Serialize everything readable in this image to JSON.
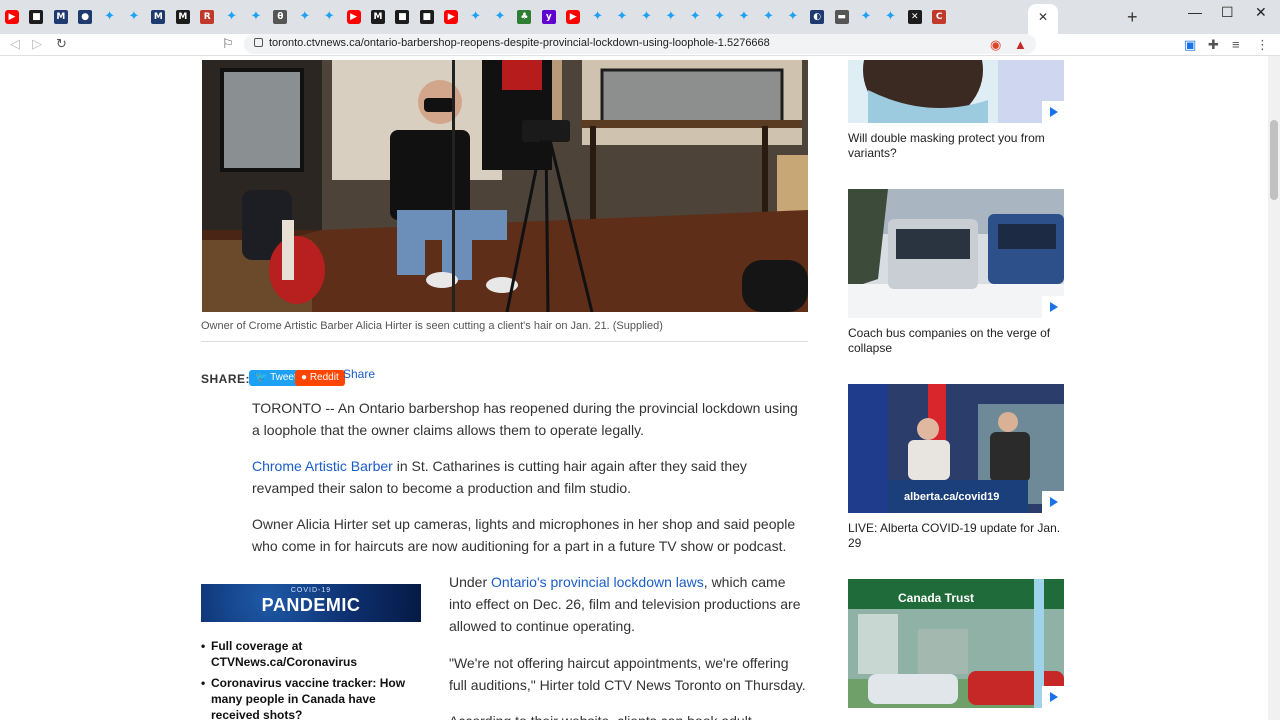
{
  "browser": {
    "url": "toronto.ctvnews.ca/ontario-barbershop-reopens-despite-provincial-lockdown-using-loophole-1.5276668",
    "new_tab_glyph": "+",
    "tab_close_glyph": "✕",
    "favicons": [
      "youtube-icon",
      "dark-square-icon",
      "navy-m-icon",
      "navy-circle-icon",
      "twitter-icon",
      "twitter-icon",
      "navy-m-icon",
      "dark-m-icon",
      "red-rcp-icon",
      "twitter-icon",
      "twitter-icon",
      "theta-icon",
      "twitter-icon",
      "twitter-icon",
      "youtube-icon",
      "dark-m-icon",
      "dark-square-icon",
      "dark-square-icon",
      "youtube-icon",
      "twitter-icon",
      "twitter-icon",
      "green-icon",
      "yahoo-icon",
      "youtube-icon",
      "twitter-icon",
      "twitter-icon",
      "twitter-icon",
      "twitter-icon",
      "twitter-icon",
      "twitter-icon",
      "twitter-icon",
      "twitter-icon",
      "twitter-icon",
      "circle-icon",
      "gray-icon",
      "twitter-icon",
      "twitter-icon",
      "dark-icon",
      "red-circle-icon"
    ]
  },
  "article": {
    "photo_caption": "Owner of Crome Artistic Barber Alicia Hirter is seen cutting a client's hair on Jan. 21. (Supplied)",
    "share_label": "SHARE:",
    "tweet_label": "Tweet",
    "reddit_label": "Reddit",
    "share_link": "Share",
    "p1": "TORONTO -- An Ontario barbershop has reopened during the provincial lockdown using a loophole that the owner claims allows them to operate legally.",
    "p2_link": "Chrome Artistic Barber",
    "p2_rest": " in St. Catharines is cutting hair again after they said they revamped their salon to become a production and film studio.",
    "p3": "Owner Alicia Hirter set up cameras, lights and microphones in her shop and said people who come in for haircuts are now auditioning for a part in a future TV show or podcast.",
    "p4_pre": "Under ",
    "p4_link": "Ontario's provincial lockdown laws",
    "p4_rest": ", which came into effect on Dec. 26, film and television productions are allowed to continue operating.",
    "p5": "\"We're not offering haircut appointments, we're offering full auditions,\" Hirter told CTV News Toronto on Thursday.",
    "p6_partial": "According to their website, clients can book adult"
  },
  "covid_box": {
    "banner_sub": "COVID-19",
    "banner_main": "PANDEMIC",
    "items": [
      "Full coverage at CTVNews.ca/Coronavirus",
      "Coronavirus vaccine tracker: How many people in Canada have received shots?"
    ]
  },
  "sidebar": {
    "videos": [
      {
        "title": "Will double masking protect you from variants?"
      },
      {
        "title": "Coach bus companies on the verge of collapse"
      },
      {
        "title": "LIVE: Alberta COVID-19 update for Jan. 29",
        "overlay": "alberta.ca/covid19"
      },
      {
        "title": "",
        "overlay": "Canada Trust"
      }
    ]
  },
  "colors": {
    "link": "#1a5cc8",
    "twitter": "#1da1f2",
    "reddit": "#ff4500",
    "play": "#1a73e8"
  }
}
